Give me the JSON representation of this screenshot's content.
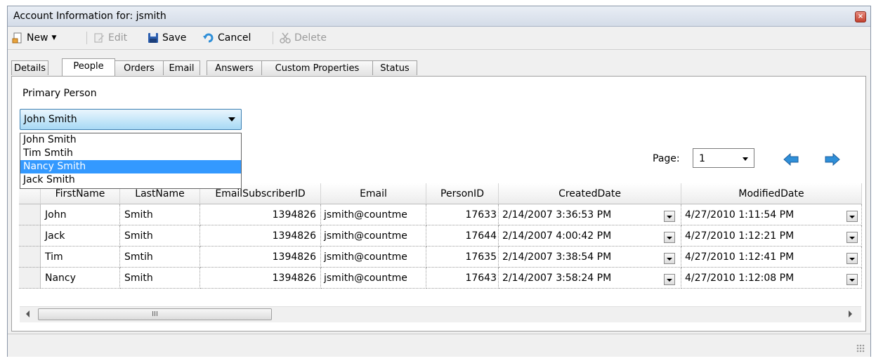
{
  "window": {
    "title": "Account Information for: jsmith",
    "close_icon": "close-icon"
  },
  "toolbar": {
    "new_label": "New",
    "edit_label": "Edit",
    "save_label": "Save",
    "cancel_label": "Cancel",
    "delete_label": "Delete"
  },
  "tabs": [
    "Details",
    "People",
    "Orders",
    "Email",
    "Answers",
    "Custom Properties",
    "Status"
  ],
  "active_tab": "People",
  "primary_person": {
    "label": "Primary Person",
    "selected": "John Smith",
    "options": [
      "John Smith",
      "Tim Smtih",
      "Nancy Smith",
      "Jack Smith"
    ],
    "highlighted": "Nancy Smith"
  },
  "pager": {
    "label": "Page:",
    "value": "1"
  },
  "grid": {
    "columns": [
      "FirstName",
      "LastName",
      "EmailSubscriberID",
      "Email",
      "PersonID",
      "CreatedDate",
      "ModifiedDate"
    ],
    "rows": [
      [
        "John",
        "Smith",
        "1394826",
        "jsmith@countme",
        "17633",
        "2/14/2007 3:36:53 PM",
        "4/27/2010 1:11:54 PM"
      ],
      [
        "Jack",
        "Smith",
        "1394826",
        "jsmith@countme",
        "17644",
        "2/14/2007 4:00:42 PM",
        "4/27/2010 1:12:21 PM"
      ],
      [
        "Tim",
        "Smtih",
        "1394826",
        "jsmith@countme",
        "17635",
        "2/14/2007 3:38:54 PM",
        "4/27/2010 1:12:41 PM"
      ],
      [
        "Nancy",
        "Smith",
        "1394826",
        "jsmith@countme",
        "17643",
        "2/14/2007 3:58:24 PM",
        "4/27/2010 1:12:08 PM"
      ]
    ]
  },
  "scrollbar": {
    "thumb_grip": "III"
  },
  "colors": {
    "highlight": "#3399ff",
    "combo": "#a7d9f5",
    "nav_arrow": "#2f8fd8"
  }
}
